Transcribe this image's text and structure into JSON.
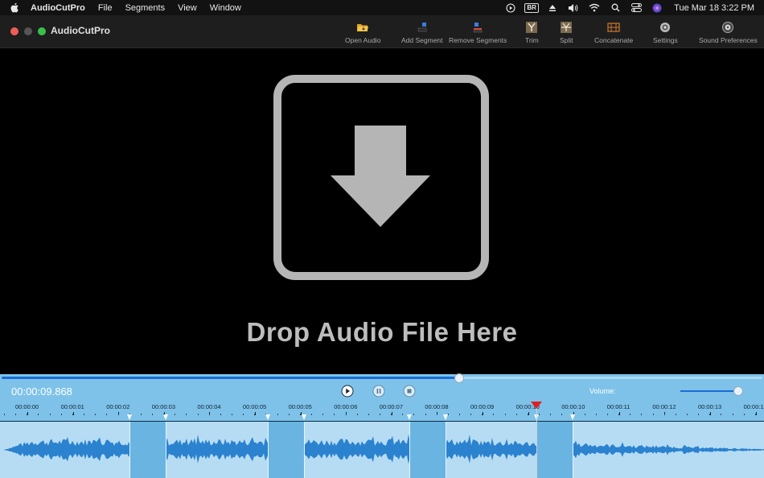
{
  "menubar": {
    "app_name": "AudioCutPro",
    "items": [
      "File",
      "Segments",
      "View",
      "Window"
    ],
    "badge": "BR",
    "clock": "Tue Mar 18  3:22 PM"
  },
  "window": {
    "title": "AudioCutPro"
  },
  "toolbar": {
    "open_audio": "Open Audio",
    "add_segment": "Add Segment",
    "remove_segments": "Remove Segments",
    "trim": "Trim",
    "split": "Split",
    "concatenate": "Concatenate",
    "settings": "Settings",
    "sound_preferences": "Sound Preferences"
  },
  "drop_zone": {
    "text": "Drop Audio File Here"
  },
  "player": {
    "timecode": "00:00:09.868",
    "progress_fraction": 0.6,
    "volume_label": "Volume:",
    "volume_fraction": 0.98
  },
  "timeline": {
    "ticks": [
      "00:00:00",
      "00:00:01",
      "00:00:02",
      "00:00:03",
      "00:00:04",
      "00:00:05",
      "00:00:05",
      "00:00:06",
      "00:00:07",
      "00:00:08",
      "00:00:09",
      "00:00:10",
      "00:00:10",
      "00:00:11",
      "00:00:12",
      "00:00:13",
      "00:00:1"
    ],
    "segments": [
      {
        "start_s": 2.2,
        "end_s": 3.0
      },
      {
        "start_s": 5.25,
        "end_s": 6.05
      },
      {
        "start_s": 8.35,
        "end_s": 9.15
      },
      {
        "start_s": 11.15,
        "end_s": 11.95
      }
    ],
    "playhead_s": 11.15
  },
  "colors": {
    "accent": "#1a6dd6",
    "panel": "#7ec2e9",
    "waveform": "#2b82cf",
    "playhead_marker": "#e02020"
  }
}
